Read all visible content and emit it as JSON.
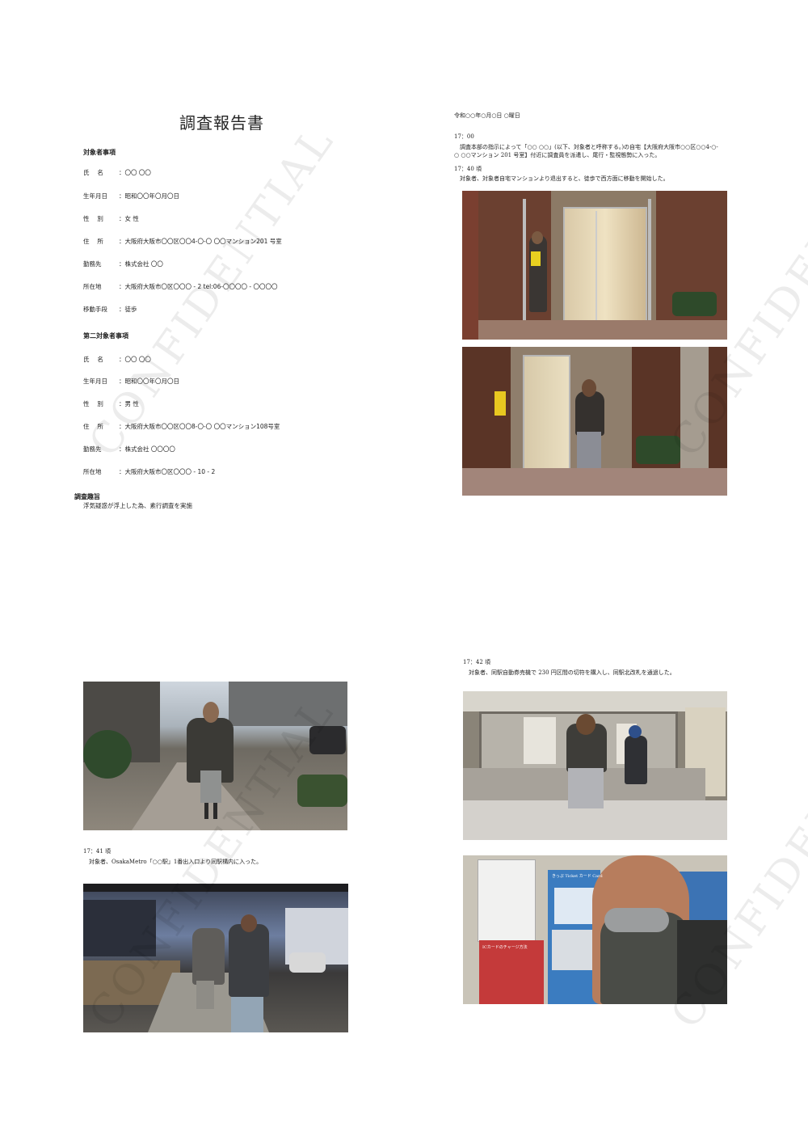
{
  "watermark": "CONFIDENTIAL",
  "page1": {
    "title": "調査報告書",
    "subject1": {
      "heading": "対象者事項",
      "fields": [
        {
          "label": "氏　 名",
          "value": "：〇〇 〇〇"
        },
        {
          "label": "生年月日",
          "value": "：昭和〇〇年〇月〇日"
        },
        {
          "label": "性　 別",
          "value": "：女 性"
        },
        {
          "label": "住　 所",
          "value": "：大阪府大阪市〇〇区〇〇4-〇-〇 〇〇マンション201 号室"
        },
        {
          "label": "勤務先",
          "value": "：株式会社 〇〇"
        },
        {
          "label": "所在地",
          "value": "：大阪府大阪市〇区〇〇〇 - 2 tel:06-〇〇〇〇 - 〇〇〇〇"
        },
        {
          "label": "移動手段",
          "value": "：徒歩"
        }
      ]
    },
    "subject2": {
      "heading": "第二対象者事項",
      "fields": [
        {
          "label": "氏　 名",
          "value": "：〇〇 〇〇"
        },
        {
          "label": "生年月日",
          "value": "：昭和〇〇年〇月〇日"
        },
        {
          "label": "性　 別",
          "value": "：男 性"
        },
        {
          "label": "住　 所",
          "value": "：大阪府大阪市〇〇区〇〇8-〇-〇 〇〇マンション108号室"
        },
        {
          "label": "勤務先",
          "value": "：株式会社 〇〇〇〇"
        },
        {
          "label": "所在地",
          "value": "：大阪府大阪市〇区〇〇〇 - 10 - 2"
        }
      ]
    },
    "purpose_heading": "調査趣旨",
    "purpose_text": "浮気疑惑が浮上した為、素行調査を実施"
  },
  "page2": {
    "date": "令和○○年○月○日 ○曜日",
    "entries": [
      {
        "time": "17：00",
        "text": "調査本部の指示によって「○○ ○○」(以下、対象者と呼称する。)の自宅【大阪府大阪市○○区○○4-○-○ ○○マンション 201 号室】付近に調査員を派遣し、尾行・監視態勢に入った。"
      },
      {
        "time": "17：40 頃",
        "text": "対象者、対象者自宅マンションより退出すると、徒歩で西方面に移動を開始した。"
      }
    ]
  },
  "page3": {
    "entry": {
      "time": "17：41 頃",
      "text": "対象者、OsakaMetro「○○駅」1番出入口より同駅構内に入った。"
    }
  },
  "page4": {
    "entry": {
      "time": "17：42 頃",
      "text": "対象者、同駅自動券売機で 230 円区間の切符を購入し、同駅北改札を通過した。"
    },
    "machine_sign": "きっぷ Ticket カード Card",
    "charge_sign": "ICカードのチャージ方法"
  }
}
